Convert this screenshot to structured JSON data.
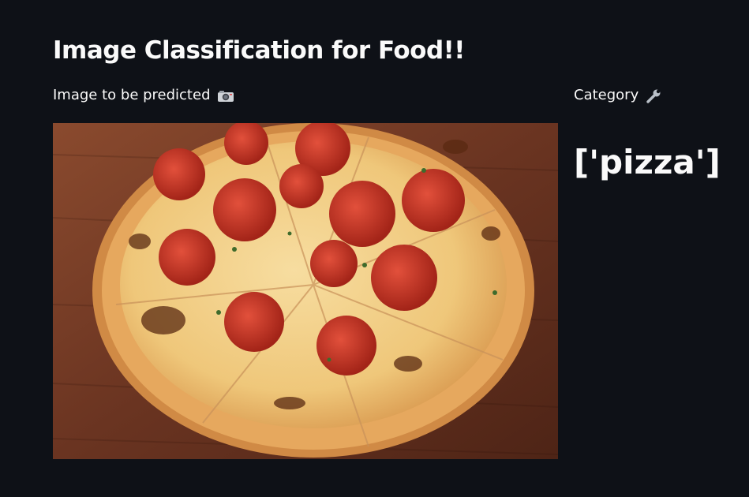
{
  "app": {
    "title": "Image Classification for Food!!"
  },
  "left_column": {
    "label": "Image to be predicted",
    "label_icon": "camera-icon",
    "image_alt_icon": "pizza-photo"
  },
  "right_column": {
    "label": "Category",
    "label_icon": "wrench-icon",
    "prediction": "['pizza']"
  },
  "colors": {
    "background": "#0e1117",
    "text": "#fafafa"
  }
}
